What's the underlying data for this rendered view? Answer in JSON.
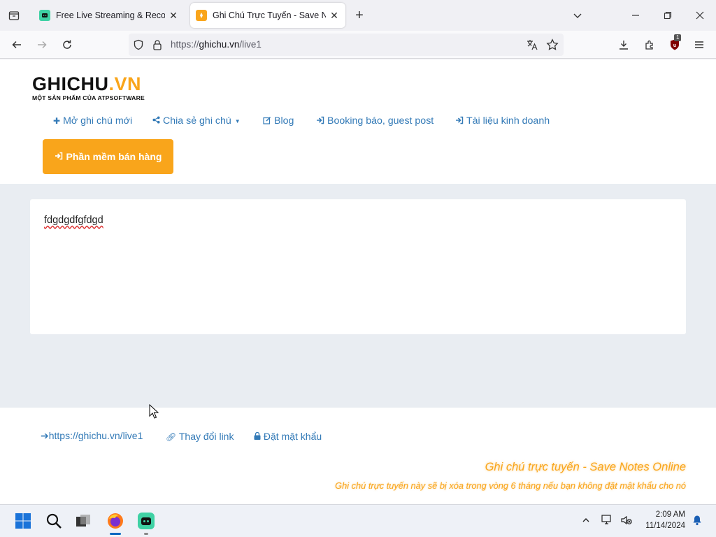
{
  "browser": {
    "tabs": [
      {
        "title": "Free Live Streaming & Recording",
        "favicon": "discord-like-icon",
        "active": false
      },
      {
        "title": "Ghi Chú Trực Tuyến - Save Notes",
        "favicon": "ghichu-icon",
        "active": true
      }
    ],
    "url_scheme": "https://",
    "url_host": "ghichu.vn",
    "url_path": "/live1",
    "extension_badge": "1"
  },
  "site": {
    "logo_part1": "GHICHU",
    "logo_part2": ".VN",
    "logo_tagline": "MỘT SẢN PHẨM CỦA ATPSOFTWARE",
    "menu": [
      {
        "label": "Mở ghi chú mới",
        "icon": "plus-icon"
      },
      {
        "label": "Chia sẻ ghi chú",
        "icon": "share-icon"
      },
      {
        "label": "Blog",
        "icon": "edit-icon"
      },
      {
        "label": "Booking báo, guest post",
        "icon": "sign-in-icon"
      },
      {
        "label": "Tài liệu kinh doanh",
        "icon": "sign-in-icon"
      }
    ],
    "sale_button": "Phần mềm bán hàng",
    "note_text": "fdgdgdfgfdgd",
    "footer": {
      "link_current": "https://ghichu.vn/live1",
      "change_link": "Thay đổi link",
      "set_password": "Đặt mật khẩu",
      "title": "Ghi chú trực tuyến - Save Notes Online",
      "subtitle": "Ghi chú trực tuyến này sẽ bị xóa trong vòng 6 tháng nếu bạn không đặt mật khẩu cho nó"
    },
    "colors": {
      "brand": "#f9a51b",
      "link": "#337ab7",
      "content_bg": "#e9edf2"
    }
  },
  "taskbar": {
    "time": "2:09 AM",
    "date": "11/14/2024"
  }
}
